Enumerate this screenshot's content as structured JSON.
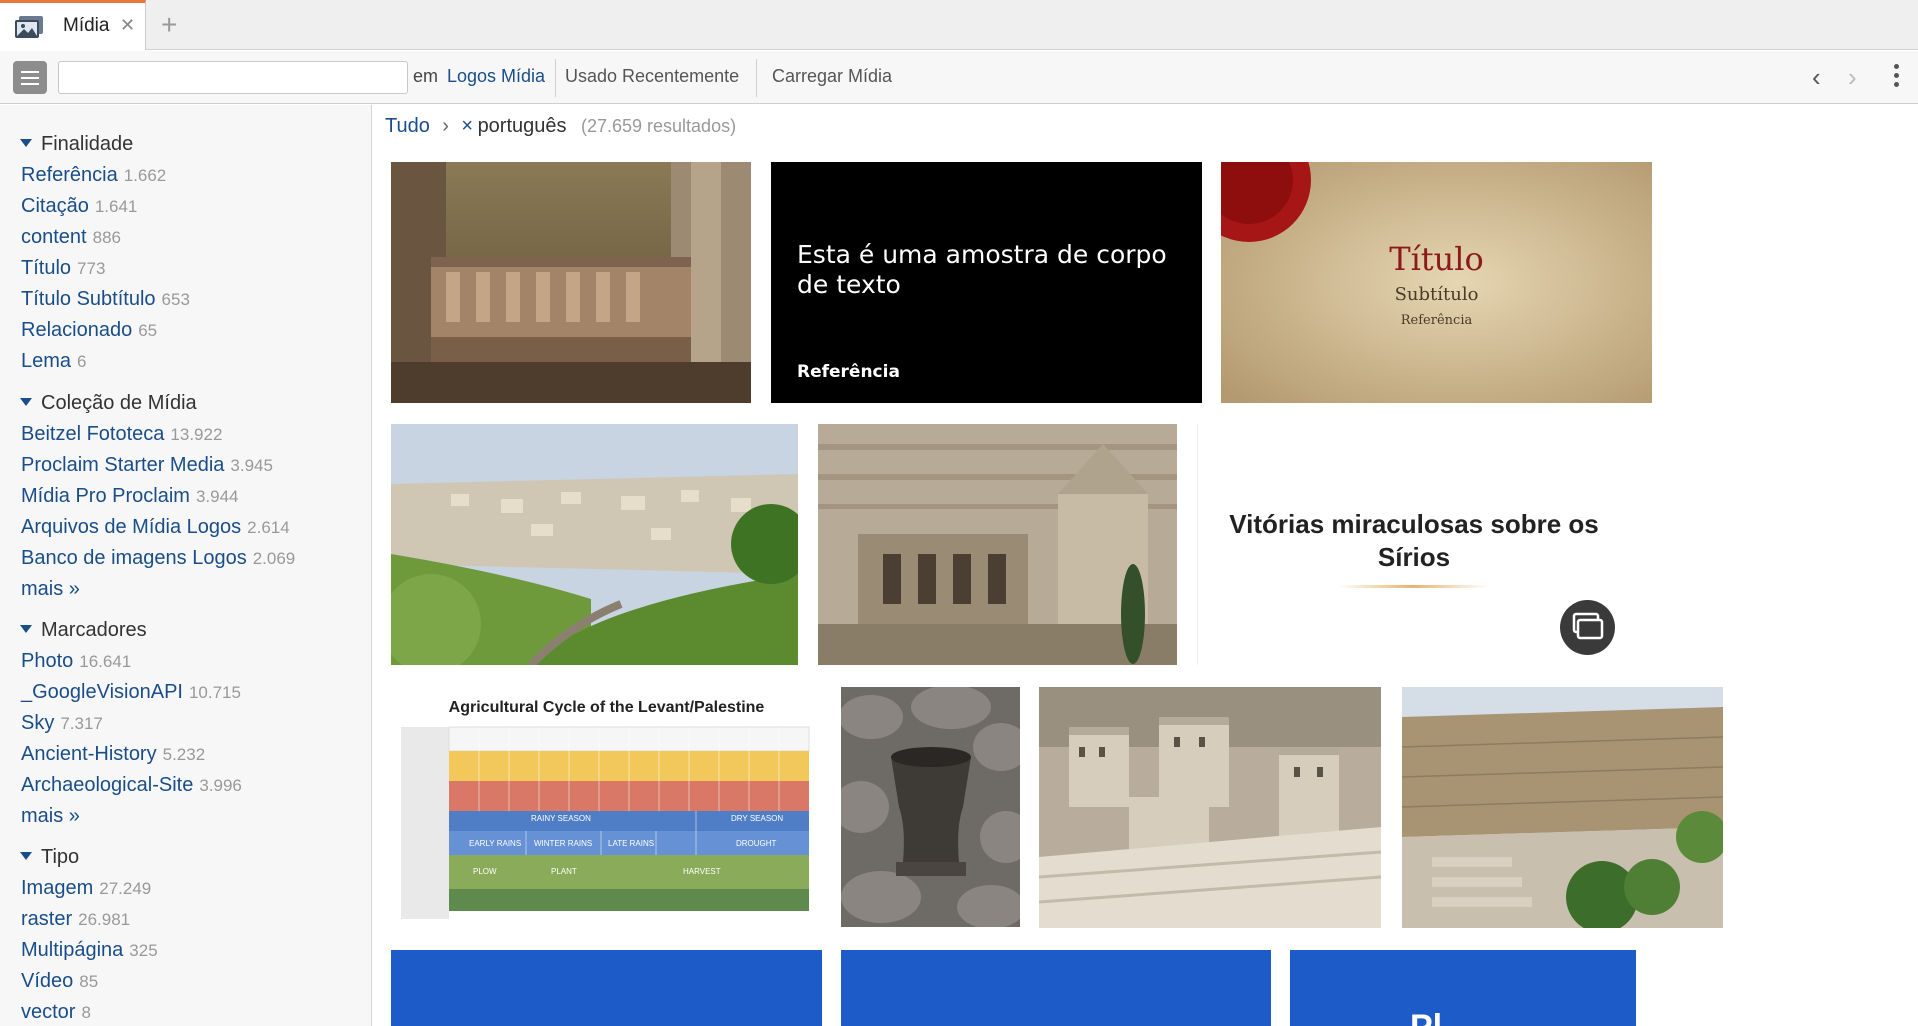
{
  "tabs": [
    {
      "label": "Mídia",
      "icon": "media-gallery-icon",
      "active": true
    }
  ],
  "toolbar": {
    "search_value": "",
    "search_placeholder": "",
    "em_label": "em",
    "scope_link": "Logos Mídia",
    "recent_label": "Usado Recentemente",
    "upload_label": "Carregar Mídia"
  },
  "sidebar": {
    "facets": [
      {
        "title": "Finalidade",
        "items": [
          {
            "label": "Referência",
            "count": "1.662"
          },
          {
            "label": "Citação",
            "count": "1.641"
          },
          {
            "label": "content",
            "count": "886"
          },
          {
            "label": "Título",
            "count": "773"
          },
          {
            "label": "Título Subtítulo",
            "count": "653"
          },
          {
            "label": "Relacionado",
            "count": "65"
          },
          {
            "label": "Lema",
            "count": "6"
          }
        ]
      },
      {
        "title": "Coleção de Mídia",
        "items": [
          {
            "label": "Beitzel Fototeca",
            "count": "13.922"
          },
          {
            "label": "Proclaim Starter Media",
            "count": "3.945"
          },
          {
            "label": "Mídia Pro Proclaim",
            "count": "3.944"
          },
          {
            "label": "Arquivos de Mídia Logos",
            "count": "2.614"
          },
          {
            "label": "Banco de imagens Logos",
            "count": "2.069"
          },
          {
            "label": "mais »",
            "count": ""
          }
        ]
      },
      {
        "title": "Marcadores",
        "items": [
          {
            "label": "Photo",
            "count": "16.641"
          },
          {
            "label": "_GoogleVisionAPI",
            "count": "10.715"
          },
          {
            "label": "Sky",
            "count": "7.317"
          },
          {
            "label": "Ancient-History",
            "count": "5.232"
          },
          {
            "label": "Archaeological-Site",
            "count": "3.996"
          },
          {
            "label": "mais »",
            "count": ""
          }
        ]
      },
      {
        "title": "Tipo",
        "items": [
          {
            "label": "Imagem",
            "count": "27.249"
          },
          {
            "label": "raster",
            "count": "26.981"
          },
          {
            "label": "Multipágina",
            "count": "325"
          },
          {
            "label": "Vídeo",
            "count": "85"
          },
          {
            "label": "vector",
            "count": "8"
          }
        ]
      }
    ]
  },
  "breadcrumb": {
    "all": "Tudo",
    "separator": "›",
    "remove": "×",
    "filter": "português",
    "result_count": "(27.659 resultados)"
  },
  "thumbnails": [
    {
      "name": "ruins-relief-photo",
      "kind": "photo"
    },
    {
      "name": "sample-text-slide",
      "kind": "slide",
      "body": "Esta é uma amostra de corpo de texto",
      "reference": "Referência"
    },
    {
      "name": "wax-seal-title-slide",
      "kind": "slide",
      "title": "Título",
      "subtitle": "Subtítulo",
      "reference": "Referência"
    },
    {
      "name": "kidron-valley-photo",
      "kind": "photo"
    },
    {
      "name": "absalom-tomb-photo",
      "kind": "photo"
    },
    {
      "name": "miraculous-victories-slide",
      "kind": "slide",
      "text": "Vitórias miraculosas sobre os Sírios"
    },
    {
      "name": "agricultural-cycle-chart",
      "kind": "image",
      "title": "Agricultural Cycle of the Levant/Palestine",
      "season_labels": [
        "RAINY SEASON",
        "DRY SEASON",
        "EARLY RAINS",
        "WINTER RAINS",
        "LATE RAINS",
        "DROUGHT",
        "PLOW",
        "PLANT",
        "HARVEST"
      ]
    },
    {
      "name": "stone-mortar-photo",
      "kind": "photo"
    },
    {
      "name": "temple-model-photo",
      "kind": "photo"
    },
    {
      "name": "southern-wall-photo",
      "kind": "photo"
    },
    {
      "name": "blue-slide-1",
      "kind": "slide"
    },
    {
      "name": "blue-slide-2",
      "kind": "slide"
    },
    {
      "name": "blue-slide-3",
      "kind": "slide",
      "partial_text": "Pl"
    }
  ],
  "colors": {
    "accent_tab": "#e8773a",
    "link": "#1a4e8a",
    "slide_blue": "#1d5cc8"
  },
  "icons": [
    "media-gallery-icon",
    "close-icon",
    "plus-icon",
    "hamburger-menu-icon",
    "chevron-left-icon",
    "chevron-right-icon",
    "more-vertical-icon",
    "caret-down-icon",
    "multi-page-icon"
  ]
}
